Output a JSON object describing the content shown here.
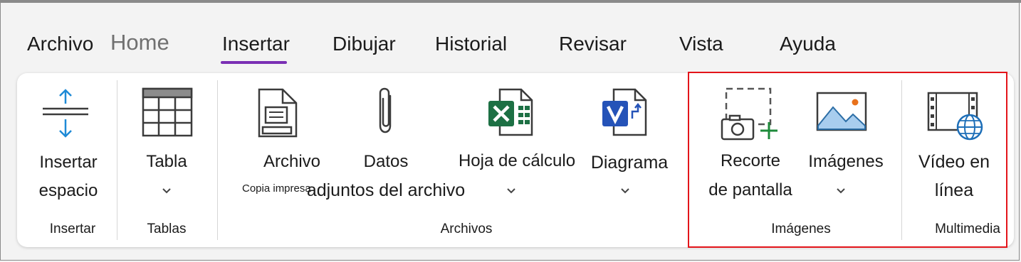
{
  "tabs": [
    "Archivo",
    "Home",
    "Insertar",
    "Dibujar",
    "Historial",
    "Revisar",
    "Vista",
    "Ayuda"
  ],
  "active_tab": "Insertar",
  "ribbon": {
    "insert_space": {
      "line1": "Insertar",
      "line2": "espacio"
    },
    "table": {
      "label": "Tabla"
    },
    "file_attachment": {
      "label": "Archivo",
      "sub_label": "Copia impresa"
    },
    "file_data": {
      "label": "Datos",
      "line2": "adjuntos del archivo"
    },
    "spreadsheet": {
      "label": "Hoja de cálculo"
    },
    "diagram": {
      "label": "Diagrama"
    },
    "screen_clipping": {
      "line1": "Recorte",
      "line2": "de pantalla"
    },
    "images": {
      "label": "Imágenes"
    },
    "online_video": {
      "line1": "Vídeo en",
      "line2": "línea"
    }
  },
  "groups": {
    "insert": "Insertar",
    "tables": "Tablas",
    "files": "Archivos",
    "images": "Imágenes",
    "media": "Multimedia"
  },
  "colors": {
    "active_tab_underline": "#7a2fb4",
    "highlight_box": "#e3141a",
    "excel_green": "#1d7044",
    "visio_blue": "#2553b8",
    "accent_blue": "#1e8ad6"
  },
  "icons": [
    "insert-space-icon",
    "table-icon",
    "file-printout-icon",
    "paperclip-icon",
    "excel-icon",
    "visio-icon",
    "screen-clipping-icon",
    "image-icon",
    "online-video-icon"
  ]
}
